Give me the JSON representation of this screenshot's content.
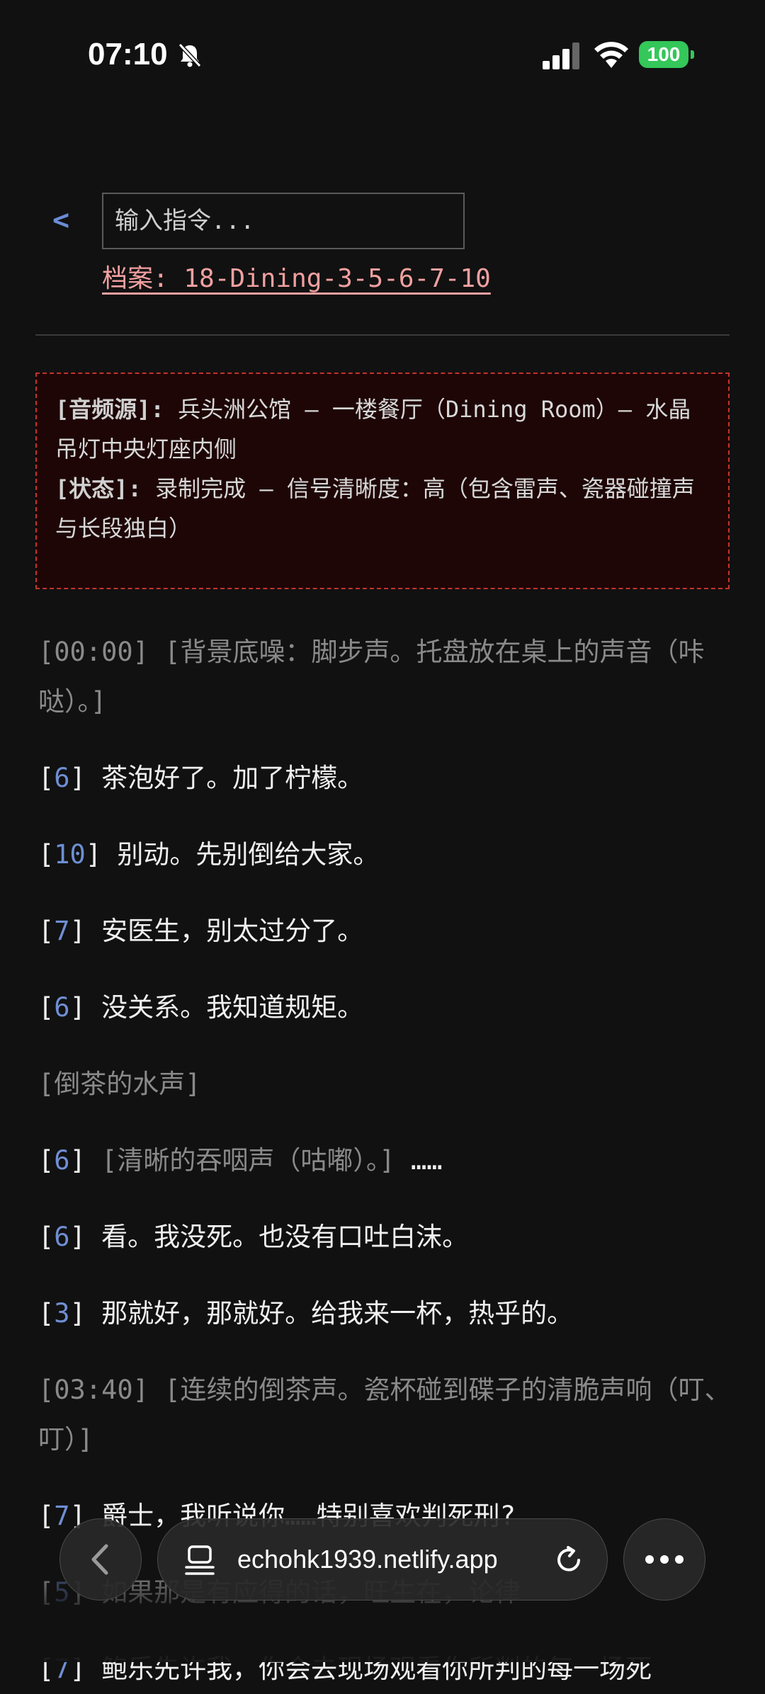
{
  "status": {
    "time": "07:10",
    "battery": "100"
  },
  "header": {
    "back_label": "<",
    "command_placeholder": "输入指令...",
    "file_label": "档案: 18-Dining-3-5-6-7-10"
  },
  "source_box": {
    "audio_label": "[音频源]:",
    "audio_text": "兵头洲公馆 – 一楼餐厅（Dining Room）– 水晶吊灯中央灯座内侧",
    "status_label": "[状态]:",
    "status_text": "录制完成 – 信号清晰度：高（包含雷声、瓷器碰撞声与长段独白）"
  },
  "transcript": {
    "l1": "[00:00] [背景底噪：脚步声。托盘放在桌上的声音（咔哒）。]",
    "l2_spk": "6",
    "l2_text": "茶泡好了。加了柠檬。",
    "l3_spk": "10",
    "l3_text": "别动。先别倒给大家。",
    "l4_spk": "7",
    "l4_text": "安医生，别太过分了。",
    "l5_spk": "6",
    "l5_text": "没关系。我知道规矩。",
    "l6": "[倒茶的水声]",
    "l7_spk": "6",
    "l7_sys": "[清晰的吞咽声（咕嘟）。]",
    "l7_text": "……",
    "l8_spk": "6",
    "l8_text": "看。我没死。也没有口吐白沫。",
    "l9_spk": "3",
    "l9_text": "那就好，那就好。给我来一杯，热乎的。",
    "l10": "[03:40] [连续的倒茶声。瓷杯碰到碟子的清脆声响（叮、叮）]",
    "l11_spk": "7",
    "l11_text": "爵士，我听说你……特别喜欢判死刑?",
    "l12_spk": "5",
    "l12_text": "如果那是有应得的话，旺生在，论律",
    "l13_spk": "7",
    "l13_text": "鲍乐先许我，你会去现场观看你所判的每一场死"
  },
  "browser": {
    "url": "echohk1939.netlify.app"
  }
}
